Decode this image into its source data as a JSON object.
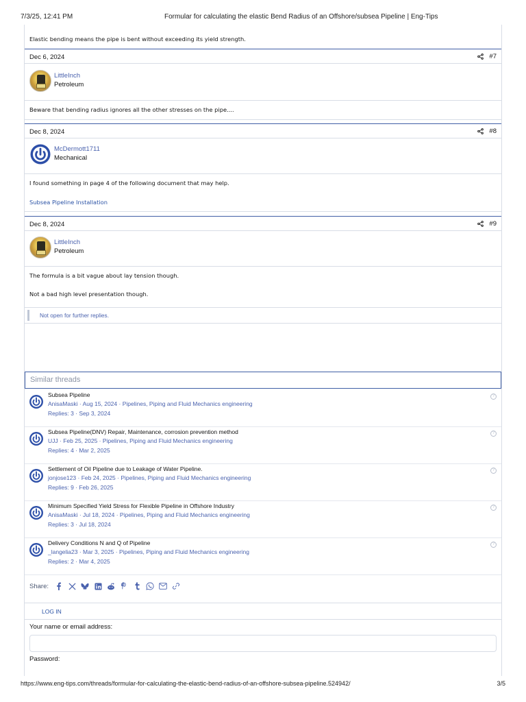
{
  "print": {
    "datetime": "7/3/25, 12:41 PM",
    "page_title": "Formular for calculating the elastic Bend Radius of an Offshore/subsea Pipeline | Eng-Tips",
    "url": "https://www.eng-tips.com/threads/formular-for-calculating-the-elastic-bend-radius-of-an-offshore-subsea-pipeline.524942/",
    "page_number": "3/5"
  },
  "top_text": "Elastic bending means the pipe is bent without exceeding its yield strength.",
  "posts": [
    {
      "date": "Dec 6, 2024",
      "number": "#7",
      "username": "LittleInch",
      "user_title": "Petroleum",
      "body": [
        "Beware that bending radius ignores all the other stresses on the pipe...."
      ]
    },
    {
      "date": "Dec 8, 2024",
      "number": "#8",
      "username": "McDermott1711",
      "user_title": "Mechanical",
      "body": [
        "I found something in page 4 of the following document that may help."
      ],
      "link": "Subsea Pipeline Installation"
    },
    {
      "date": "Dec 8, 2024",
      "number": "#9",
      "username": "LittleInch",
      "user_title": "Petroleum",
      "body": [
        "The formula is a bit vague about lay tension though.",
        "Not a bad high level presentation though."
      ]
    }
  ],
  "closed_notice": "Not open for further replies.",
  "similar": {
    "heading": "Similar threads",
    "threads": [
      {
        "title": "Subsea Pipeline",
        "author": "AnisaMaski",
        "date": "Aug 15, 2024",
        "forum": "Pipelines, Piping and Fluid Mechanics engineering",
        "replies": "Replies: 3 · Sep 3, 2024"
      },
      {
        "title": "Subsea Pipeline(DNV) Repair, Maintenance, corrosion prevention method",
        "author": "UJJ",
        "date": "Feb 25, 2025",
        "forum": "Pipelines, Piping and Fluid Mechanics engineering",
        "replies": "Replies: 4 · Mar 2, 2025"
      },
      {
        "title": "Settlement of Oil Pipeline due to Leakage of Water Pipeline.",
        "author": "jonjose123",
        "date": "Feb 24, 2025",
        "forum": "Pipelines, Piping and Fluid Mechanics engineering",
        "replies": "Replies: 9 · Feb 26, 2025"
      },
      {
        "title": "Minimum Specified Yield Stress for Flexible Pipeline in Offshore Industry",
        "author": "AnisaMaski",
        "date": "Jul 18, 2024",
        "forum": "Pipelines, Piping and Fluid Mechanics engineering",
        "replies": "Replies: 3 · Jul 18, 2024"
      },
      {
        "title": "Delivery Conditions N and Q of Pipeline",
        "author": "_langelia23",
        "date": "Mar 3, 2025",
        "forum": "Pipelines, Piping and Fluid Mechanics engineering",
        "replies": "Replies: 2 · Mar 4, 2025"
      }
    ]
  },
  "share": {
    "label": "Share:",
    "icons": [
      "facebook-icon",
      "x-icon",
      "bluesky-icon",
      "linkedin-icon",
      "reddit-icon",
      "pinterest-icon",
      "tumblr-icon",
      "whatsapp-icon",
      "email-icon",
      "link-icon"
    ]
  },
  "login": {
    "tab": "LOG IN",
    "name_label": "Your name or email address:",
    "password_label": "Password:"
  },
  "colors": {
    "accent": "#3f5ea5",
    "link": "#4a62ae",
    "border": "#d8dde6"
  }
}
